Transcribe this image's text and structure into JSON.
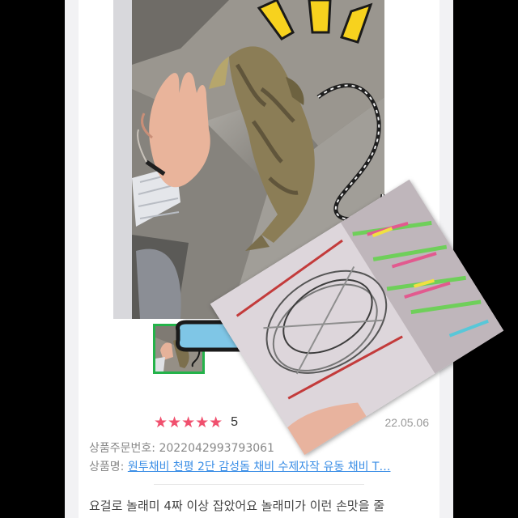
{
  "review": {
    "rating_value": "5",
    "stars": "★★★★★",
    "date": "22.05.06",
    "order_label": "상품주문번호:",
    "order_number": "2022042993793061",
    "product_label": "상품명:",
    "product_name": "원투채비 천평 2단 감성돔 채비 수제자작 유동 채비 T…",
    "text": "요걸로 놀래미 4짜 이상 잡았어요 놀래미가 이런 손맛을 줄"
  },
  "icons": {
    "star": "star-icon",
    "arrow": "arrow-right-icon",
    "sparkle": "sparkle-icon"
  },
  "colors": {
    "star": "#f0506e",
    "link": "#3a8ee6",
    "thumb_border": "#24b34a",
    "arrow_fill": "#7fc6e6",
    "sparkle": "#f7d21e"
  }
}
